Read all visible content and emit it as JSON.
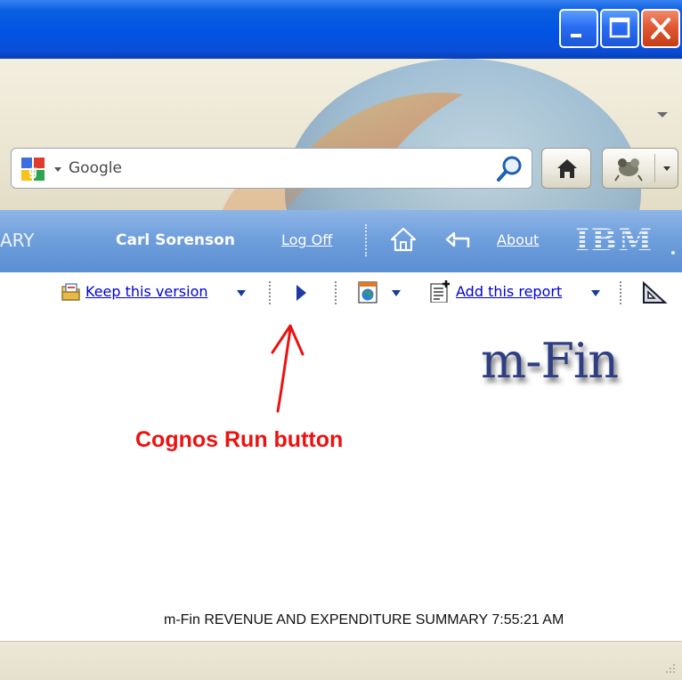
{
  "window": {
    "buttons": [
      "minimize",
      "maximize",
      "close"
    ]
  },
  "browser": {
    "search": {
      "engine_icon": "google-logo-icon",
      "placeholder": "Google"
    },
    "buttons": [
      "magnifier-icon",
      "home-icon",
      "addon-icon"
    ]
  },
  "cognos": {
    "header": {
      "title_fragment": "ARY",
      "user": "Carl Sorenson",
      "logoff": "Log Off",
      "about": "About",
      "brand": "IBM"
    },
    "toolbar": {
      "keep_version": "Keep this version",
      "add_report": "Add this report"
    }
  },
  "content": {
    "logo_text": "m-Fin",
    "annotation": "Cognos Run button",
    "report_line": "m-Fin REVENUE AND EXPENDITURE SUMMARY 7:55:21 AM"
  },
  "colors": {
    "titlebar": "#0054e3",
    "header_band": "#6f9fdc",
    "link": "#0000d8",
    "annotation": "#ee1111",
    "logo": "#2e3e82"
  }
}
